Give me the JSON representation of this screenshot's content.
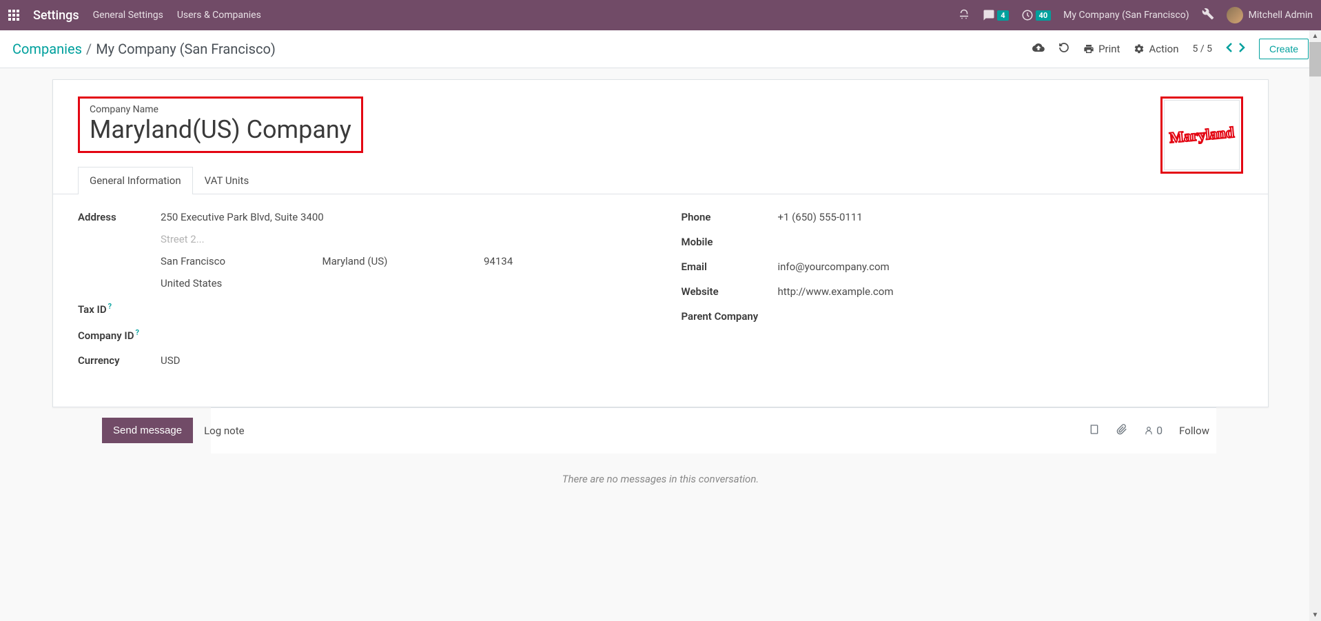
{
  "nav": {
    "title": "Settings",
    "links": [
      "General Settings",
      "Users & Companies"
    ],
    "conversations_count": "4",
    "activities_count": "40",
    "company": "My Company (San Francisco)",
    "user": "Mitchell Admin"
  },
  "control": {
    "breadcrumb_root": "Companies",
    "breadcrumb_current": "My Company (San Francisco)",
    "print": "Print",
    "action": "Action",
    "pager": "5 / 5",
    "create": "Create"
  },
  "form": {
    "name_label": "Company Name",
    "name": "Maryland(US) Company",
    "logo_text": "Maryland",
    "tabs": [
      "General Information",
      "VAT Units"
    ],
    "fields": {
      "address_label": "Address",
      "street": "250 Executive Park Blvd, Suite 3400",
      "street2_placeholder": "Street 2...",
      "city": "San Francisco",
      "state": "Maryland (US)",
      "zip": "94134",
      "country": "United States",
      "tax_id_label": "Tax ID",
      "company_id_label": "Company ID",
      "currency_label": "Currency",
      "currency": "USD",
      "phone_label": "Phone",
      "phone": "+1 (650) 555-0111",
      "mobile_label": "Mobile",
      "email_label": "Email",
      "email": "info@yourcompany.com",
      "website_label": "Website",
      "website": "http://www.example.com",
      "parent_label": "Parent Company"
    }
  },
  "chatter": {
    "send": "Send message",
    "log": "Log note",
    "followers": "0",
    "follow": "Follow",
    "empty": "There are no messages in this conversation."
  }
}
